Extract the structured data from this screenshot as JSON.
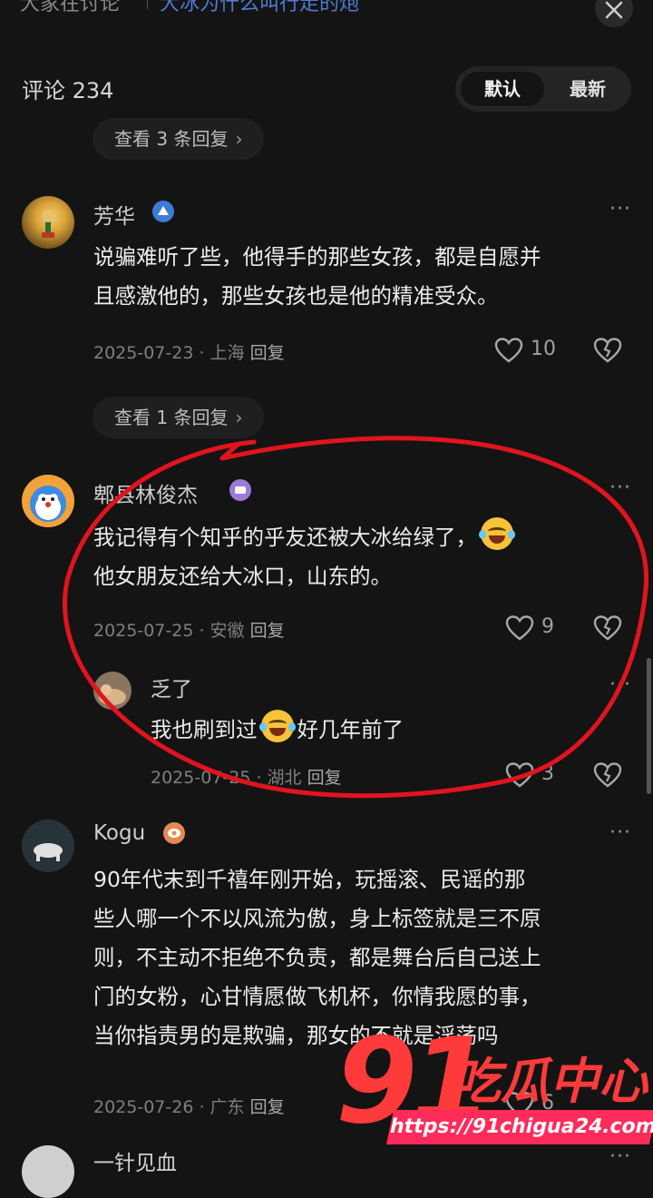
{
  "header": {
    "prefix": "大家在讨论",
    "topic": "大冰为什么叫行走的炮"
  },
  "comments_header": {
    "count_label": "评论 234",
    "sort_default": "默认",
    "sort_latest": "最新"
  },
  "reply_pills": {
    "first": "查看 3 条回复",
    "second": "查看 1 条回复"
  },
  "comments": [
    {
      "username": "芳华",
      "text": "说骗难听了些，他得手的那些女孩，都是自愿并且感激他的，那些女孩也是他的精准受众。",
      "line1": "说骗难听了些，他得手的那些女孩，都是自愿并",
      "line2": "且感激他的，那些女孩也是他的精准受众。",
      "date": "2025-07-23",
      "location": "上海",
      "reply_label": "回复",
      "likes": "10"
    },
    {
      "username": "郫县林俊杰",
      "line1": "我记得有个知乎的乎友还被大冰给绿了，",
      "line2": "他女朋友还给大冰口，山东的。",
      "date": "2025-07-25",
      "location": "安徽",
      "reply_label": "回复",
      "likes": "9"
    },
    {
      "username": "乏了",
      "part1": "我也刷到过",
      "part2": "好几年前了",
      "date": "2025-07-25",
      "location": "湖北",
      "reply_label": "回复",
      "likes": "3"
    },
    {
      "username": "Kogu",
      "line1": "90年代末到千禧年刚开始，玩摇滚、民谣的那",
      "line2": "些人哪一个不以风流为傲，身上标签就是三不原",
      "line3": "则，不主动不拒绝不负责，都是舞台后自己送上",
      "line4": "门的女粉，心甘情愿做飞机杯，你情我愿的事，",
      "line5": "当你指责男的是欺骗，那女的不就是淫荡吗",
      "date": "2025-07-26",
      "location": "广东",
      "reply_label": "回复",
      "likes": "6"
    },
    {
      "username": "一针见血"
    }
  ],
  "watermark": {
    "big": "91",
    "cn": "吃瓜中心",
    "url": "https://91chigua24.com"
  },
  "icons": {
    "close": "close-icon",
    "more": "more-icon",
    "like": "heart-icon",
    "dislike": "broken-heart-icon",
    "emoji": "rofl-emoji-icon"
  },
  "colors": {
    "background": "#141414",
    "link": "#4d7bd6",
    "annotation": "#e1141e",
    "watermark": "#ff3a3a"
  }
}
